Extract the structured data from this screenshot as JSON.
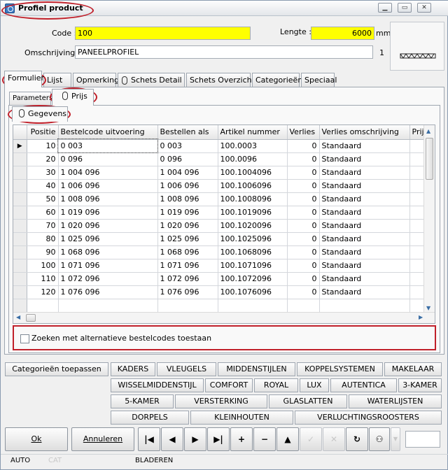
{
  "window": {
    "title": "Profiel product"
  },
  "form": {
    "code_label": "Code :",
    "code_value": "100",
    "lengte_label": "Lengte :",
    "lengte_value": "6000",
    "lengte_unit": "mm",
    "omschrijving_label": "Omschrijving :",
    "omschrijving_value": "PANEELPROFIEL",
    "omschrijving_count": "1"
  },
  "tabs": [
    "Formulier",
    "Lijst",
    "Opmerking",
    "Schets Detail",
    "Schets Overzicht",
    "Categorieën",
    "Speciaal"
  ],
  "subtabs": {
    "parameters": "Parameters",
    "prijs": "Prijs",
    "gegevens": "Gegevens"
  },
  "grid": {
    "headers": [
      "Positie",
      "Bestelcode uitvoering",
      "Bestellen als",
      "Artikel nummer",
      "Verlies",
      "Verlies omschrijving",
      "Prijs"
    ],
    "rows": [
      [
        "10",
        "0 003",
        "0 003",
        "100.0003",
        "0",
        "Standaard"
      ],
      [
        "20",
        "0 096",
        "0 096",
        "100.0096",
        "0",
        "Standaard"
      ],
      [
        "30",
        "1 004 096",
        "1 004 096",
        "100.1004096",
        "0",
        "Standaard"
      ],
      [
        "40",
        "1 006 096",
        "1 006 096",
        "100.1006096",
        "0",
        "Standaard"
      ],
      [
        "50",
        "1 008 096",
        "1 008 096",
        "100.1008096",
        "0",
        "Standaard"
      ],
      [
        "60",
        "1 019 096",
        "1 019 096",
        "100.1019096",
        "0",
        "Standaard"
      ],
      [
        "70",
        "1 020 096",
        "1 020 096",
        "100.1020096",
        "0",
        "Standaard"
      ],
      [
        "80",
        "1 025 096",
        "1 025 096",
        "100.1025096",
        "0",
        "Standaard"
      ],
      [
        "90",
        "1 068 096",
        "1 068 096",
        "100.1068096",
        "0",
        "Standaard"
      ],
      [
        "100",
        "1 071 096",
        "1 071 096",
        "100.1071096",
        "0",
        "Standaard"
      ],
      [
        "110",
        "1 072 096",
        "1 072 096",
        "100.1072096",
        "0",
        "Standaard"
      ],
      [
        "120",
        "1 076 096",
        "1 076 096",
        "100.1076096",
        "0",
        "Standaard"
      ]
    ]
  },
  "checkbox": {
    "label": "Zoeken met alternatieve bestelcodes toestaan",
    "checked": false
  },
  "categories": {
    "apply_label": "Categorieën toepassen",
    "row1": [
      "KADERS",
      "VLEUGELS",
      "MIDDENSTIJLEN",
      "KOPPELSYSTEMEN",
      "MAKELAAR"
    ],
    "row2": [
      "WISSELMIDDENSTIJL",
      "COMFORT",
      "ROYAL",
      "LUX",
      "AUTENTICA",
      "3-KAMER"
    ],
    "row3": [
      "5-KAMER",
      "VERSTERKING",
      "GLASLATTEN",
      "WATERLIJSTEN"
    ],
    "row4": [
      "DORPELS",
      "KLEINHOUTEN",
      "VERLUCHTINGSROOSTERS"
    ]
  },
  "buttons": {
    "ok": "Ok",
    "annuleren": "Annuleren"
  },
  "status": {
    "auto": "AUTO",
    "cat": "CAT",
    "mode": "BLADEREN"
  },
  "colors": {
    "highlight_yellow": "#ffff00",
    "annotation_red": "#c0202a"
  }
}
